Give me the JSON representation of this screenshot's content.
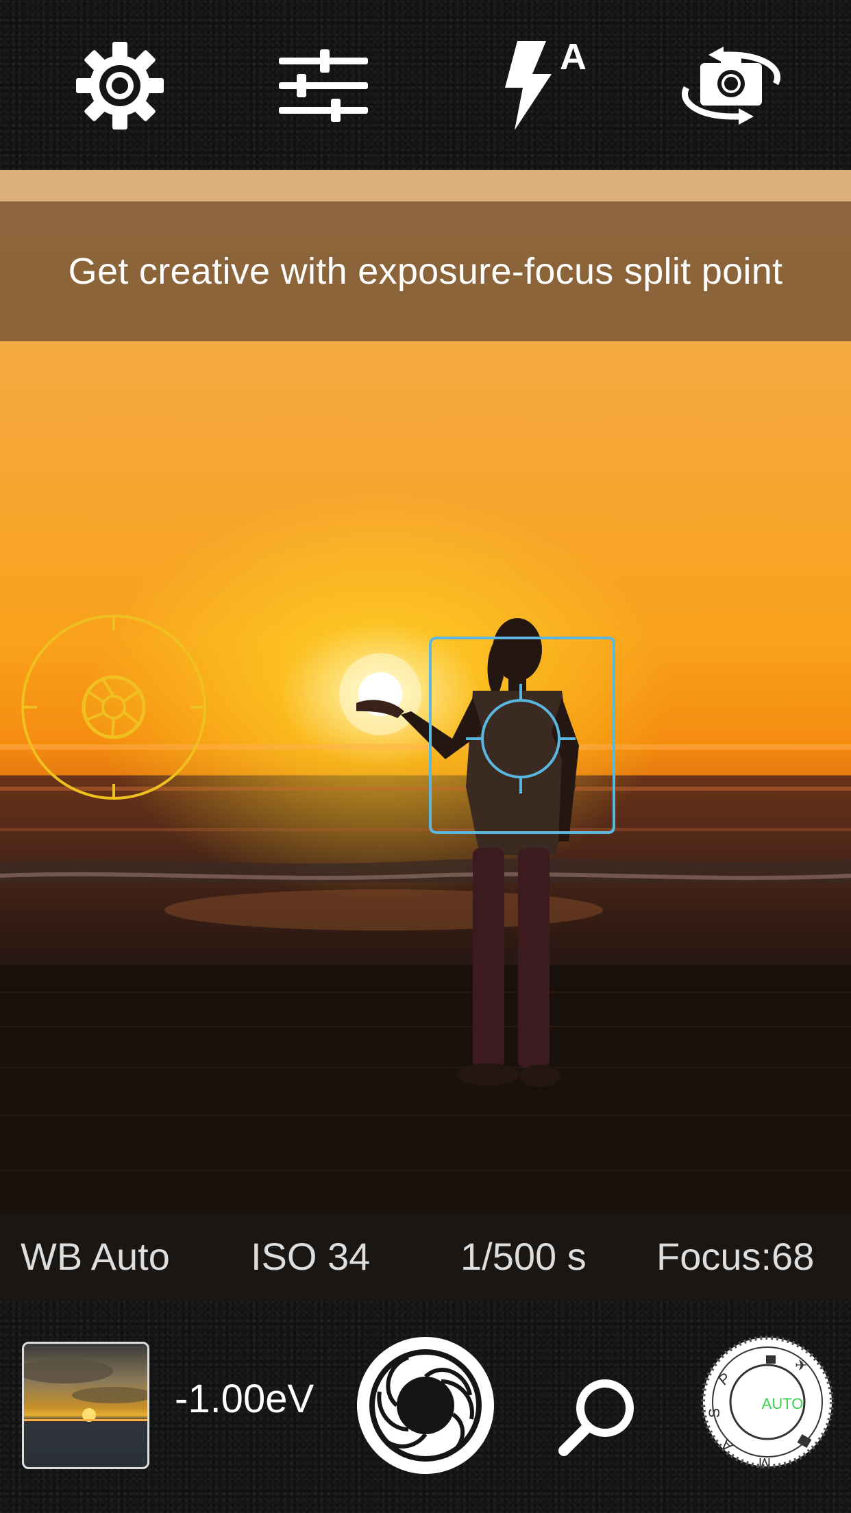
{
  "toolbar": {
    "settings_icon": "gear-icon",
    "adjustments_icon": "sliders-icon",
    "flash_icon": "flash-auto-icon",
    "flash_mode_label": "A",
    "switch_camera_icon": "camera-switch-icon"
  },
  "tip": {
    "text": "Get creative with exposure-focus split point"
  },
  "reticles": {
    "exposure_icon": "aperture-icon",
    "focus_icon": "focus-reticle-icon"
  },
  "info": {
    "white_balance": "WB Auto",
    "iso": "ISO 34",
    "shutter": "1/500 s",
    "focus": "Focus:68"
  },
  "bottom": {
    "exposure_value": "-1.00eV",
    "shutter_icon": "shutter-icon",
    "zoom_icon": "magnifier-icon",
    "mode_dial": {
      "selected": "AUTO",
      "letters": [
        "S",
        "A",
        "M",
        "P"
      ]
    }
  },
  "colors": {
    "exposure_reticle": "#f0c020",
    "focus_reticle": "#5ab8e0",
    "dial_auto": "#3ccf4e"
  }
}
